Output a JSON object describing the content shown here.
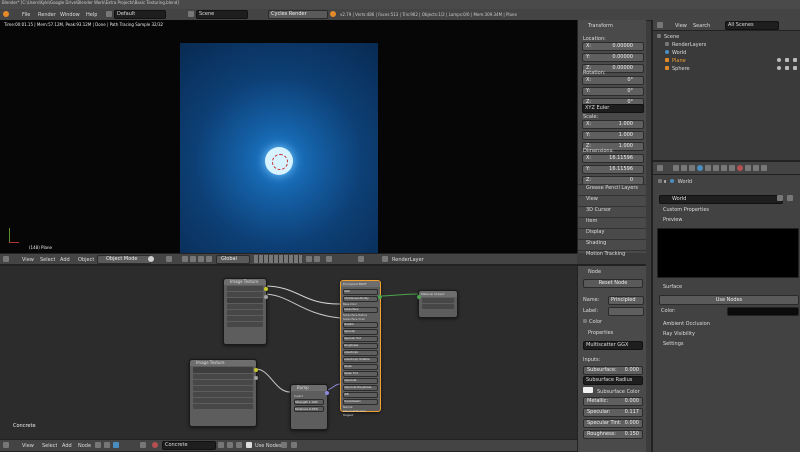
{
  "window": {
    "title": "Blender* [C:\\Users\\Kyle\\Google Drive\\Blender Work\\Extra Projects\\Basic Texturing.blend]"
  },
  "menu": {
    "items": [
      "File",
      "Render",
      "Window",
      "Help"
    ],
    "layout": "Default",
    "scene": "Scene",
    "engine": "Cycles Render",
    "stats": "v2.79 | Verts:486 | Faces:513 | Tris:962 | Objects:1/2 | Lamps:0/0 | Mem:309.34M | Plane"
  },
  "viewport": {
    "status": "Time:00:01.15 | Mem:57.12M, Peak:93.12M | Done | Path Tracing Sample 32/32",
    "object_label": "(148) Plane",
    "header": {
      "menus": [
        "View",
        "Select",
        "Add",
        "Object"
      ],
      "mode": "Object Mode",
      "orientation": "Global",
      "render_layer": "RenderLayer"
    }
  },
  "transform": {
    "title": "Transform",
    "location_label": "Location:",
    "location": [
      {
        "axis": "X:",
        "value": "0.00000"
      },
      {
        "axis": "Y:",
        "value": "0.00000"
      },
      {
        "axis": "Z:",
        "value": "0.00000"
      }
    ],
    "rotation_label": "Rotation:",
    "rotation": [
      {
        "axis": "X:",
        "value": "0°"
      },
      {
        "axis": "Y:",
        "value": "0°"
      },
      {
        "axis": "Z:",
        "value": "0°"
      }
    ],
    "rotation_mode": "XYZ Euler",
    "scale_label": "Scale:",
    "scale": [
      {
        "axis": "X:",
        "value": "1.000"
      },
      {
        "axis": "Y:",
        "value": "1.000"
      },
      {
        "axis": "Z:",
        "value": "1.000"
      }
    ],
    "dimensions_label": "Dimensions:",
    "dimensions": [
      {
        "axis": "X:",
        "value": "16.11596"
      },
      {
        "axis": "Y:",
        "value": "16.11596"
      },
      {
        "axis": "Z:",
        "value": "0"
      }
    ],
    "sections": [
      "Grease Pencil Layers",
      "View",
      "3D Cursor",
      "Item",
      "Display",
      "Shading",
      "Motion Tracking"
    ]
  },
  "outliner": {
    "menus": [
      "View",
      "Search"
    ],
    "filter": "All Scenes",
    "tree": [
      "Scene",
      "RenderLayers",
      "World",
      "Plane",
      "Sphere"
    ]
  },
  "properties": {
    "breadcrumb": "World",
    "world_field": "World",
    "sections": [
      "Custom Properties",
      "Preview"
    ],
    "surface_title": "Surface",
    "use_nodes_label": "Use Nodes",
    "color_label": "Color:",
    "bottom_sections": [
      "Ambient Occlusion",
      "Ray Visibility",
      "Settings"
    ]
  },
  "node_panel": {
    "title": "Node",
    "reset_label": "Reset Node",
    "name_label": "Name:",
    "name_value": "Principled",
    "label_label": "Label:",
    "color_section": "Color",
    "properties_section": "Properties",
    "distribution": "Multiscatter GGX",
    "inputs_label": "Inputs:",
    "subsurface_method": "Subsurface Radius",
    "subsurface_color_label": "Subsurface Color",
    "inputs": [
      {
        "label": "Subsurface:",
        "value": "0.000"
      },
      {
        "label": "Metallic:",
        "value": "0.000"
      },
      {
        "label": "Specular:",
        "value": "0.117"
      },
      {
        "label": "Specular Tint:",
        "value": "0.000"
      },
      {
        "label": "Roughness:",
        "value": "0.150"
      }
    ]
  },
  "node_editor": {
    "material_name": "Concrete",
    "header": {
      "menus": [
        "View",
        "Select",
        "Add",
        "Node"
      ],
      "material": "Concrete",
      "use_nodes": "Use Nodes"
    },
    "nodes": {
      "image1": "Image Texture",
      "image2": "Image Texture",
      "principled": "Principled BSDF",
      "bump": "Bump",
      "output": "Material Output",
      "bump_rows": [
        "Invert",
        "Strength 1.000",
        "Distance 0.050"
      ],
      "principled_rows": [
        "GGX",
        "Christensen-Burley",
        "Base Color",
        "Subsurface",
        "Subsurface Radius",
        "Subsurface Color",
        "Metallic",
        "Specular",
        "Specular Tint",
        "Roughness",
        "Anisotropic",
        "Anisotropic Rotation",
        "Sheen",
        "Sheen Tint",
        "Clearcoat",
        "Clearcoat Roughness",
        "IOR",
        "Transmission",
        "Normal",
        "Clearcoat Normal",
        "Tangent"
      ]
    }
  }
}
